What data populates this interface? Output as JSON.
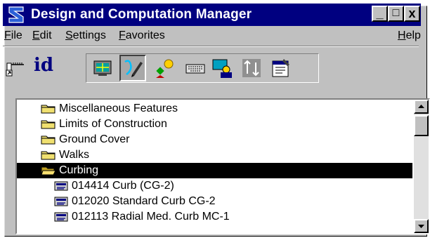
{
  "window": {
    "title": "Design and Computation Manager",
    "controls": {
      "minimize": "_",
      "maximize": "□",
      "close": "x"
    }
  },
  "menu": {
    "file": "File",
    "edit": "Edit",
    "settings": "Settings",
    "favorites": "Favorites",
    "help": "Help"
  },
  "toolbar": {
    "id_label": "id",
    "tools": [
      "ruler-tool-icon",
      "id-icon",
      "grid-view-icon",
      "design-pencil-icon",
      "shapes-icon",
      "keyboard-icon",
      "monitor-user-icon",
      "up-down-arrows-icon",
      "properties-icon"
    ]
  },
  "tree": {
    "items": [
      {
        "label": "Miscellaneous Features",
        "type": "folder"
      },
      {
        "label": "Limits of Construction",
        "type": "folder"
      },
      {
        "label": "Ground Cover",
        "type": "folder"
      },
      {
        "label": "Walks",
        "type": "folder"
      },
      {
        "label": "Curbing",
        "type": "folder-open",
        "selected": true
      },
      {
        "label": "014414 Curb (CG-2)",
        "type": "item"
      },
      {
        "label": "012020 Standard Curb CG-2",
        "type": "item"
      },
      {
        "label": "012113 Radial Med. Curb MC-1",
        "type": "item"
      }
    ]
  },
  "colors": {
    "title_bar": "#000080",
    "selection": "#000000",
    "folder": "#f0e070"
  }
}
